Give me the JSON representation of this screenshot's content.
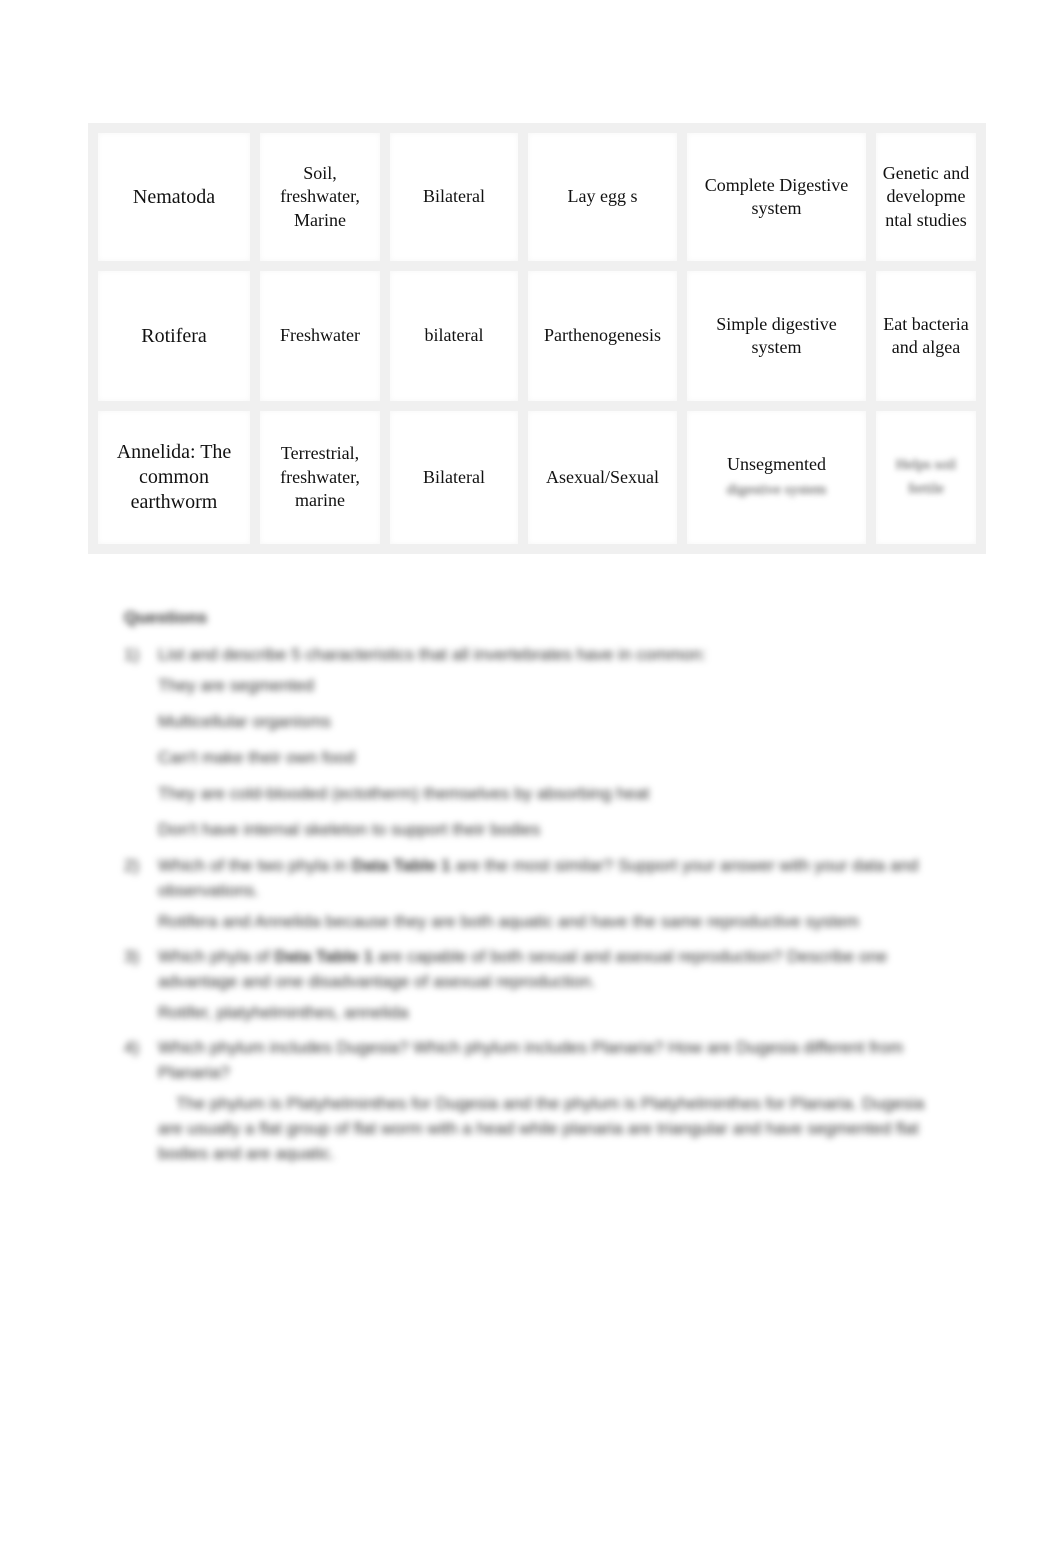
{
  "table": {
    "rows": [
      {
        "phylum": "Nematoda",
        "habitat": "Soil, freshwater, Marine",
        "symmetry": "Bilateral",
        "reproduction": "Lay egg s",
        "digestive": "Complete Digestive system",
        "notes": "Genetic and developme ntal studies"
      },
      {
        "phylum": "Rotifera",
        "habitat": "Freshwater",
        "symmetry": "bilateral",
        "reproduction": "Parthenogenesis",
        "digestive": "Simple digestive system",
        "notes": "Eat bacteria and algea"
      },
      {
        "phylum": "Annelida: The common earthworm",
        "habitat": "Terrestrial, freshwater, marine",
        "symmetry": "Bilateral",
        "reproduction": "Asexual/Sexual",
        "digestive": "Unsegmented",
        "digestive_blurred": "digestive system",
        "notes_blurred": "Helps soil fertile"
      }
    ]
  },
  "questions": {
    "heading": "Questions",
    "items": [
      {
        "number": "1)",
        "text": "List and describe 5 characteristics that all invertebrates have in common:",
        "answers": [
          "They are segmented",
          "Multicellular organisms",
          "Can't make their own food",
          "They are cold-blooded (ectotherm) themselves by absorbing heat",
          "Don't have internal skeleton to support their bodies"
        ]
      },
      {
        "number": "2)",
        "text_pre": "Which of the two phyla in ",
        "text_bold": "Data Table 1",
        "text_post": " are the most similar? Support your answer with your data and observations.",
        "answers": [
          "Rotifera and Annelida because they are both aquatic and have the same reproductive system"
        ]
      },
      {
        "number": "3)",
        "text_pre": "Which phyla of ",
        "text_bold": "Data Table 1",
        "text_post": " are capable of both sexual and asexual reproduction? Describe one advantage and one disadvantage of asexual reproduction.",
        "answers": [
          "Rotifer, platyhelminthes, annelida"
        ]
      },
      {
        "number": "4)",
        "text": "Which phylum includes Dugesia? Which phylum includes Planaria? How are Dugesia different from Planaria?",
        "answers": [
          "The phylum is Platyhelminthes for Dugesia and the phylum is Platyhelminthes for Planaria. Dugesia are usually a flat group of flat worm with a head while planaria are triangular and have segmented flat bodies and are aquatic."
        ]
      }
    ]
  }
}
